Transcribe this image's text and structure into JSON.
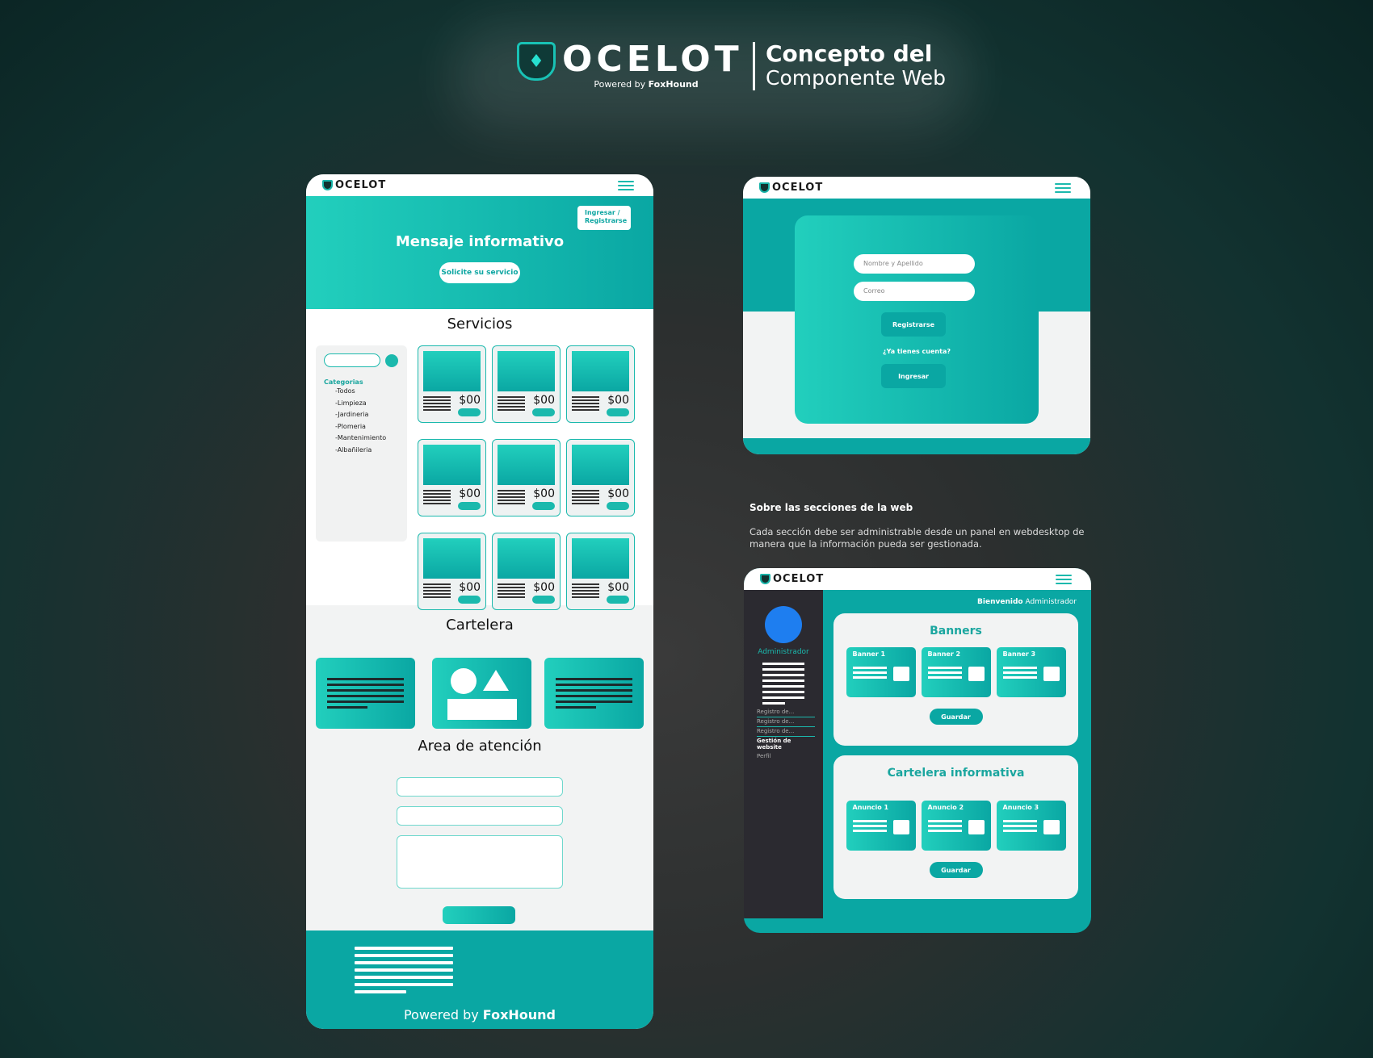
{
  "header": {
    "brand": "OCELOT",
    "powered_prefix": "Powered by ",
    "powered_brand": "FoxHound",
    "title_line1": "Concepto del",
    "title_line2": "Componente Web"
  },
  "mobile": {
    "brand": "OCELOT",
    "login_tag": "Ingresar / Registrarse",
    "hero_title": "Mensaje informativo",
    "hero_button": "Solicite su servicio",
    "services_title": "Servicios",
    "categories_title": "Categorias",
    "categories": [
      "-Todos",
      "-Limpieza",
      "-Jardineria",
      "-Plomeria",
      "-Mantenimiento",
      "-Albañileria"
    ],
    "price": "$00",
    "billboard_title": "Cartelera",
    "contact_title": "Area de atención",
    "footer_prefix": "Powered by ",
    "footer_brand": "FoxHound"
  },
  "register": {
    "brand": "OCELOT",
    "name_placeholder": "Nombre y Apellido",
    "email_placeholder": "Correo",
    "register_button": "Registrarse",
    "question": "¿Ya tienes cuenta?",
    "login_button": "Ingresar"
  },
  "sections_note": {
    "title": "Sobre las secciones de la web",
    "body": "Cada sección debe ser administrable desde un panel en webdesktop de manera que la información pueda ser gestionada."
  },
  "admin": {
    "brand": "OCELOT",
    "user_name": "Administrador",
    "welcome_bold": "Bienvenido",
    "welcome_rest": " Administrador",
    "menu": [
      "Registro de...",
      "Registro de...",
      "Registro de...",
      "Gestión de website",
      "Perfil"
    ],
    "banners_title": "Banners",
    "banners": [
      "Banner 1",
      "Banner 2",
      "Banner 3"
    ],
    "board_title": "Cartelera informativa",
    "ads": [
      "Anuncio 1",
      "Anuncio 2",
      "Anuncio 3"
    ],
    "save_label": "Guardar"
  },
  "colors": {
    "accent": "#0aa7a3",
    "accent_light": "#22cfbd",
    "sidebar": "#2b2a30",
    "avatar": "#1e7ef0"
  }
}
